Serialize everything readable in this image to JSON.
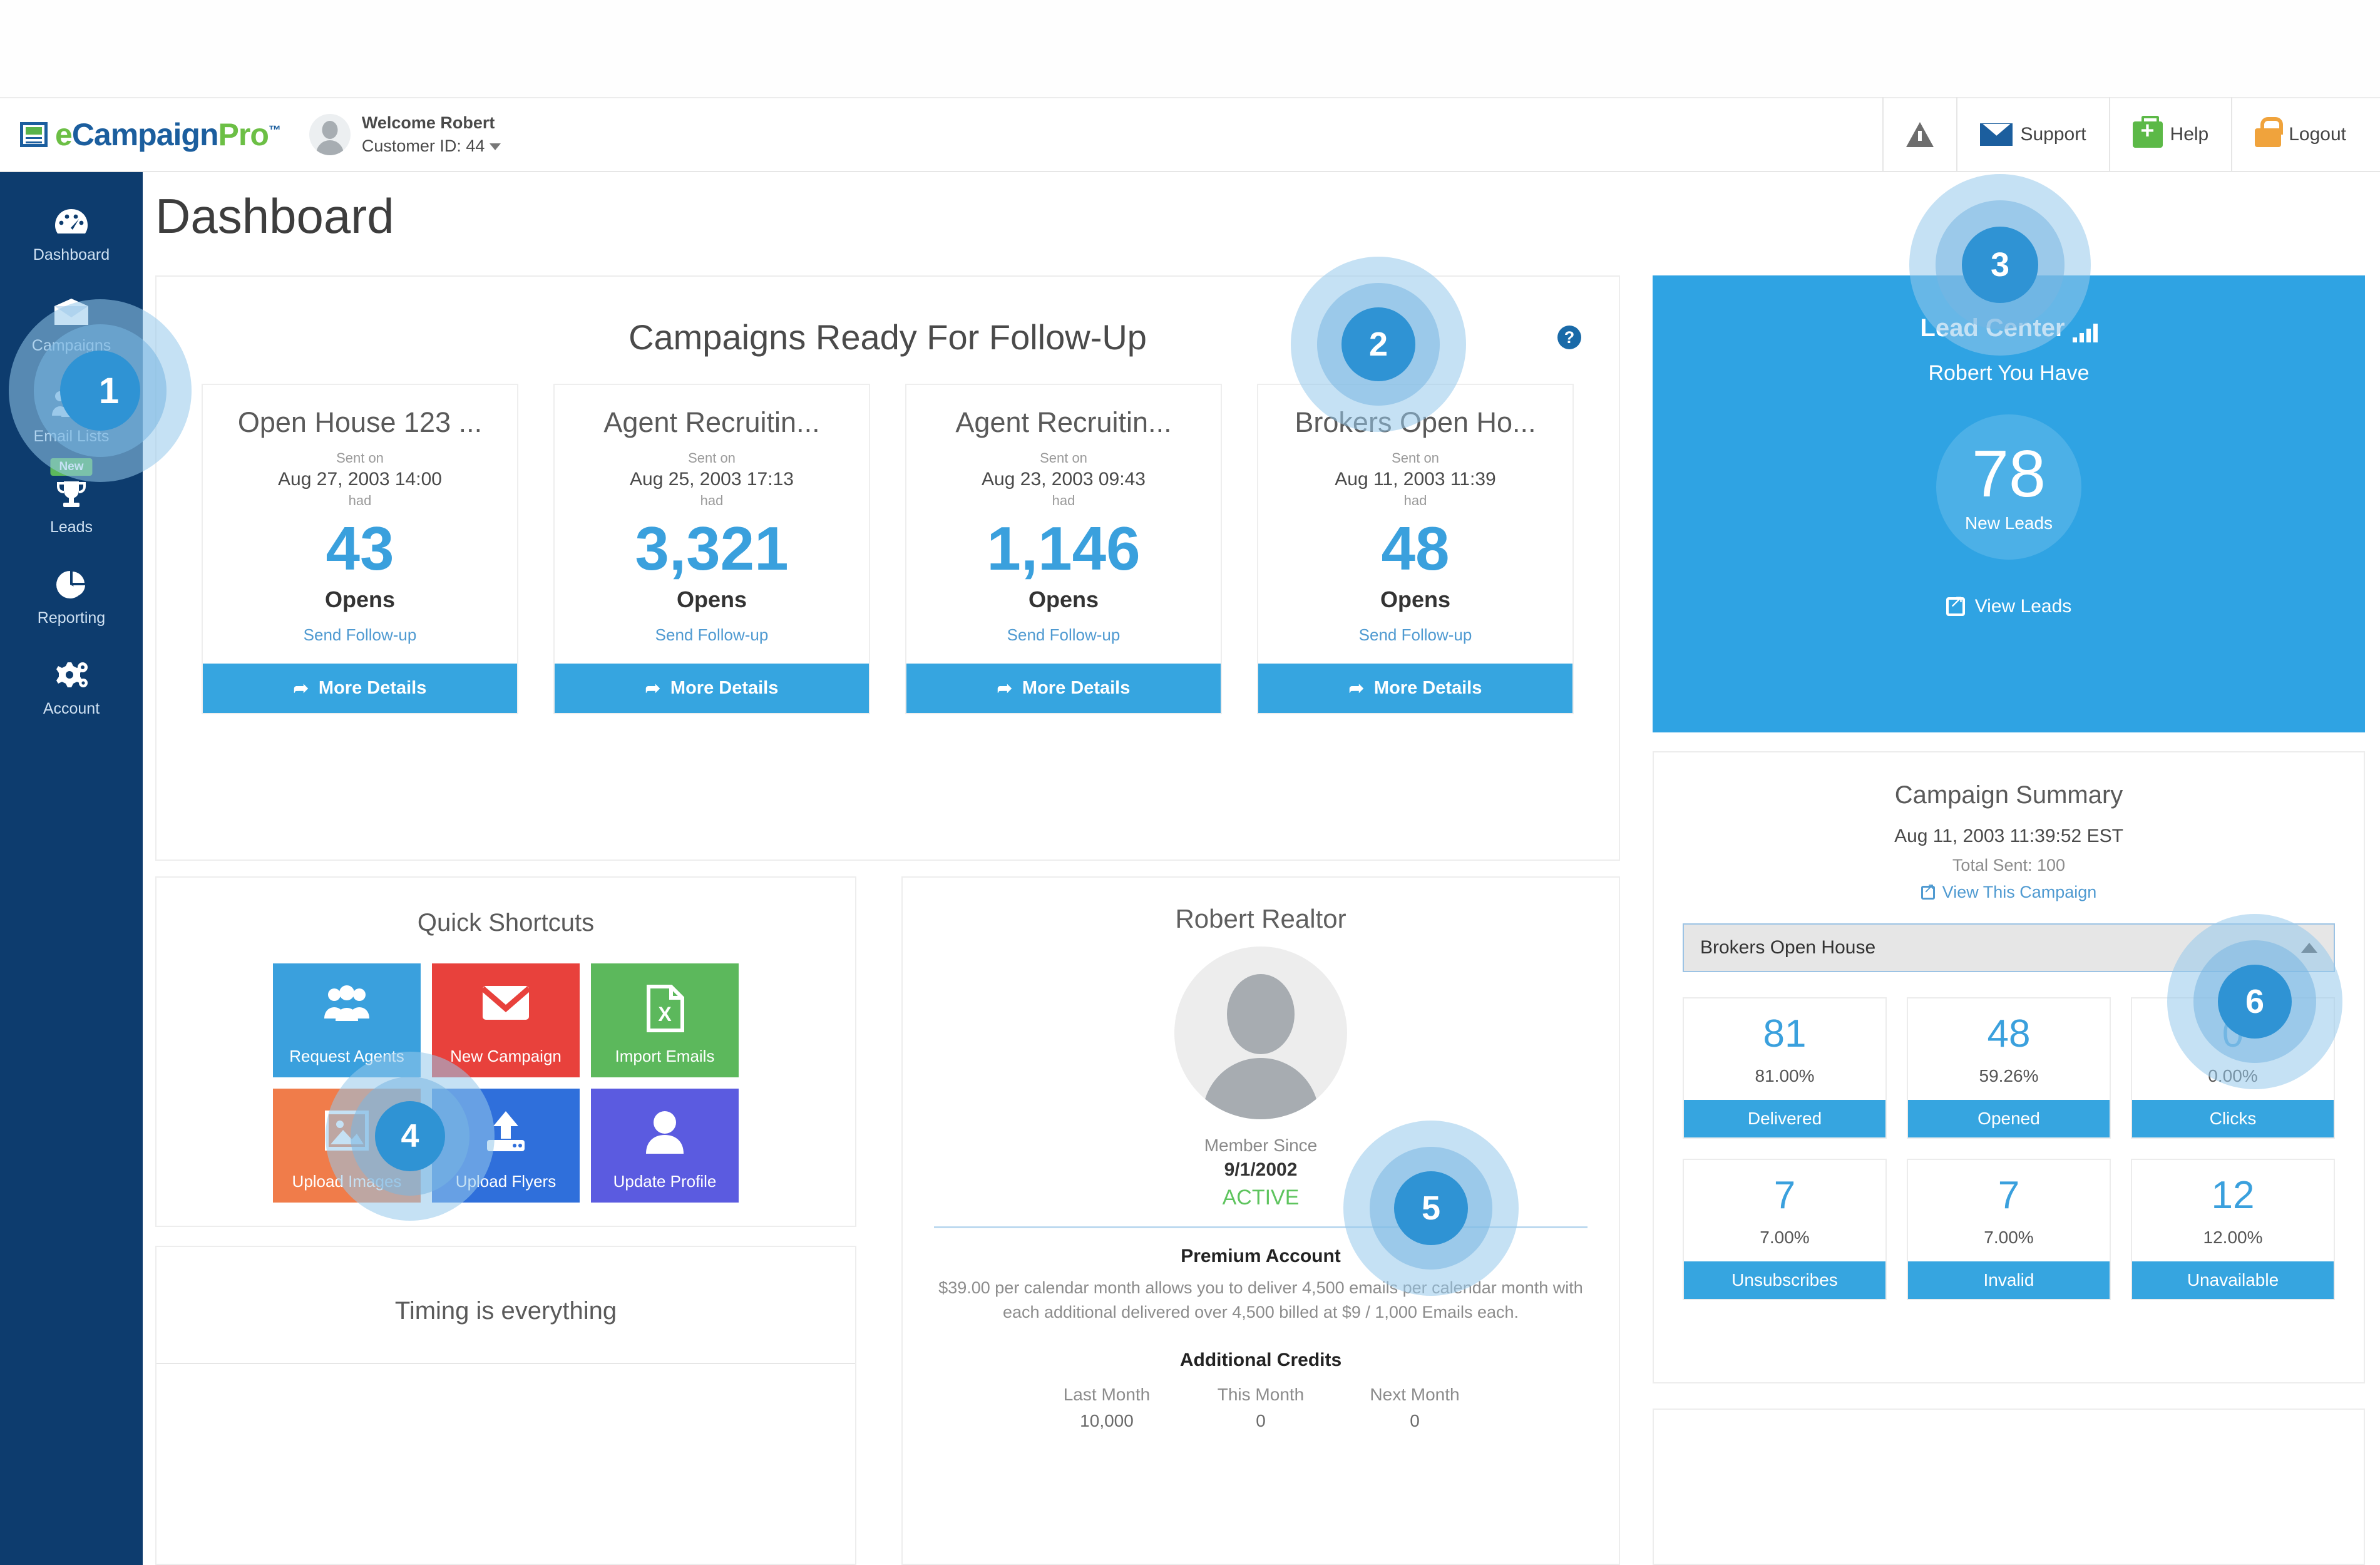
{
  "header": {
    "logo": {
      "e": "e",
      "campaign": "Campaign",
      "pro": "Pro",
      "tm": "™",
      "icon": "document-window-icon"
    },
    "welcome_line1": "Welcome Robert",
    "welcome_line2": "Customer ID: 44",
    "avatar_icon": "user-avatar",
    "buttons": [
      {
        "label": "",
        "icon": "warning-triangle-icon",
        "name": "alert-button"
      },
      {
        "label": "Support",
        "icon": "envelope-icon",
        "name": "support-button"
      },
      {
        "label": "Help",
        "icon": "first-aid-kit-icon",
        "name": "help-button"
      },
      {
        "label": "Logout",
        "icon": "lock-icon",
        "name": "logout-button"
      }
    ]
  },
  "sidebar": {
    "items": [
      {
        "label": "Dashboard",
        "icon": "dashboard-gauge-icon",
        "badge": null
      },
      {
        "label": "Campaigns",
        "icon": "envelope-open-icon",
        "badge": null
      },
      {
        "label": "Email Lists",
        "icon": "users-group-icon",
        "badge": null
      },
      {
        "label": "Leads",
        "icon": "trophy-icon",
        "badge": "New"
      },
      {
        "label": "Reporting",
        "icon": "pie-chart-icon",
        "badge": null
      },
      {
        "label": "Account",
        "icon": "gears-icon",
        "badge": null
      }
    ]
  },
  "page": {
    "title": "Dashboard"
  },
  "followup": {
    "heading": "Campaigns Ready For Follow-Up",
    "help_icon": "question-mark-icon",
    "sent_on_label": "Sent on",
    "had_label": "had",
    "opens_label": "Opens",
    "follow_up_label": "Send Follow-up",
    "more_details_label": "More Details",
    "cards": [
      {
        "name": "Open House 123 ...",
        "date": "Aug 27, 2003 14:00",
        "opens": "43"
      },
      {
        "name": "Agent Recruitin...",
        "date": "Aug 25, 2003 17:13",
        "opens": "3,321"
      },
      {
        "name": "Agent Recruitin...",
        "date": "Aug 23, 2003 09:43",
        "opens": "1,146"
      },
      {
        "name": "Brokers Open Ho...",
        "date": "Aug 11, 2003 11:39",
        "opens": "48"
      }
    ]
  },
  "shortcuts": {
    "heading": "Quick Shortcuts",
    "tiles": [
      {
        "label": "Request Agents",
        "color": "#3aa0dd",
        "icon": "users-group-icon"
      },
      {
        "label": "New Campaign",
        "color": "#e8413c",
        "icon": "envelope-icon"
      },
      {
        "label": "Import Emails",
        "color": "#5cb85c",
        "icon": "excel-file-icon"
      },
      {
        "label": "Upload Images",
        "color": "#f07c4a",
        "icon": "image-icon"
      },
      {
        "label": "Upload Flyers",
        "color": "#2f6fdb",
        "icon": "upload-icon"
      },
      {
        "label": "Update Profile",
        "color": "#5b5be0",
        "icon": "person-icon"
      }
    ]
  },
  "profile": {
    "name": "Robert Realtor",
    "avatar_icon": "user-avatar",
    "member_since_label": "Member Since",
    "member_since_value": "9/1/2002",
    "status": "ACTIVE",
    "account_type": "Premium Account",
    "account_desc": "$39.00 per calendar month allows you to deliver 4,500 emails per calendar month with each additional delivered over 4,500 billed at $9 / 1,000 Emails each.",
    "credits_heading": "Additional Credits",
    "credits": [
      {
        "label": "Last Month",
        "value": "10,000"
      },
      {
        "label": "This Month",
        "value": "0"
      },
      {
        "label": "Next Month",
        "value": "0"
      }
    ]
  },
  "timing": {
    "heading": "Timing is everything"
  },
  "lead_center": {
    "title": "Lead Center",
    "chart_icon": "signal-bars-icon",
    "subtitle": "Robert You Have",
    "count": "78",
    "count_label": "New Leads",
    "view_label": "View Leads",
    "view_icon": "external-link-icon",
    "bg_color": "#2fa3e3"
  },
  "summary": {
    "title": "Campaign Summary",
    "date": "Aug 11, 2003 11:39:52 EST",
    "total_sent": "Total Sent: 100",
    "view_link": "View This Campaign",
    "view_icon": "external-link-icon",
    "selected_campaign": "Brokers Open House",
    "dropdown_icon": "caret-up-icon",
    "tiles": [
      {
        "value": "81",
        "percent": "81.00%",
        "label": "Delivered"
      },
      {
        "value": "48",
        "percent": "59.26%",
        "label": "Opened"
      },
      {
        "value": "0",
        "percent": "0.00%",
        "label": "Clicks"
      },
      {
        "value": "7",
        "percent": "7.00%",
        "label": "Unsubscribes"
      },
      {
        "value": "7",
        "percent": "7.00%",
        "label": "Invalid"
      },
      {
        "value": "12",
        "percent": "12.00%",
        "label": "Unavailable"
      }
    ]
  },
  "annotations": [
    {
      "num": "1"
    },
    {
      "num": "2"
    },
    {
      "num": "3"
    },
    {
      "num": "4"
    },
    {
      "num": "5"
    },
    {
      "num": "6"
    }
  ]
}
